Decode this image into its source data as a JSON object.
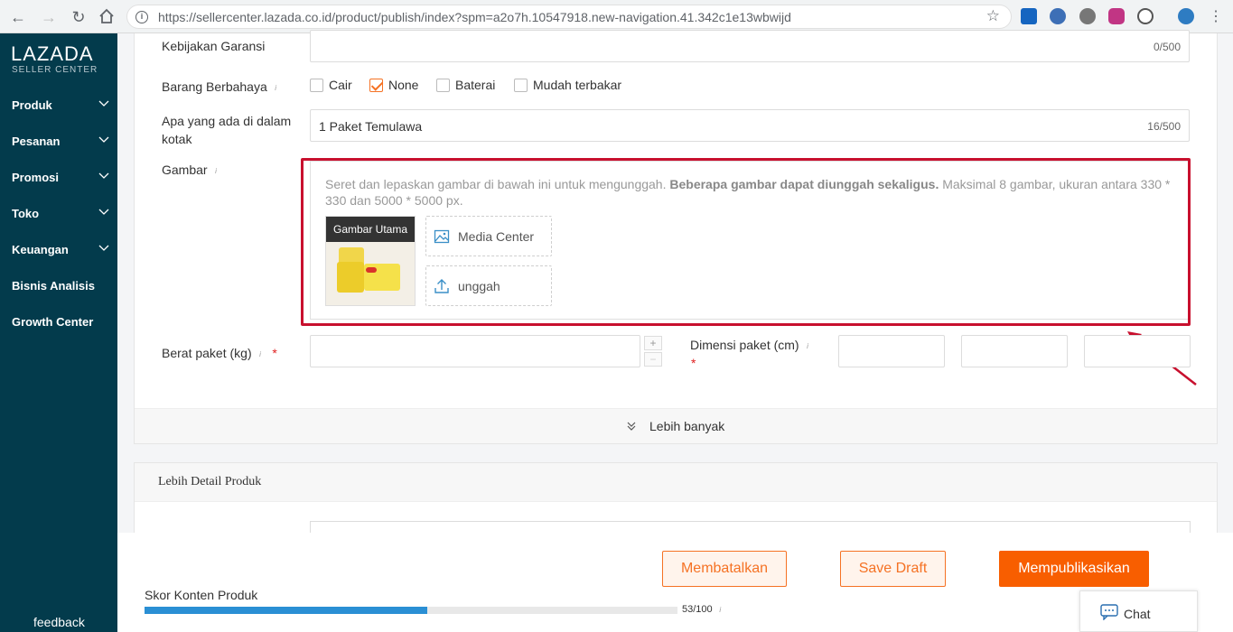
{
  "browser": {
    "url": "https://sellercenter.lazada.co.id/product/publish/index?spm=a2o7h.10547918.new-navigation.41.342c1e13wbwijd"
  },
  "sidebar": {
    "brand": "LAZADA",
    "brand_sub": "SELLER CENTER",
    "items": [
      {
        "label": "Produk",
        "has_chevron": true
      },
      {
        "label": "Pesanan",
        "has_chevron": true
      },
      {
        "label": "Promosi",
        "has_chevron": true
      },
      {
        "label": "Toko",
        "has_chevron": true
      },
      {
        "label": "Keuangan",
        "has_chevron": true
      },
      {
        "label": "Bisnis Analisis",
        "has_chevron": false
      },
      {
        "label": "Growth Center",
        "has_chevron": false
      }
    ],
    "feedback": "feedback"
  },
  "form": {
    "warranty": {
      "label": "Kebijakan Garansi",
      "value": "",
      "count": "0/500"
    },
    "dangerous": {
      "label": "Barang Berbahaya",
      "options": [
        {
          "label": "Cair",
          "checked": false
        },
        {
          "label": "None",
          "checked": true
        },
        {
          "label": "Baterai",
          "checked": false
        },
        {
          "label": "Mudah terbakar",
          "checked": false
        }
      ]
    },
    "box_contents": {
      "label_line1": "Apa yang ada di dalam",
      "label_line2": "kotak",
      "value": "1 Paket Temulawa",
      "count": "16/500"
    },
    "images": {
      "label": "Gambar",
      "hint_prefix": "Seret dan lepaskan gambar di bawah ini untuk mengunggah. ",
      "hint_bold": "Beberapa gambar dapat diunggah sekaligus.",
      "hint_suffix": " Maksimal 8 gambar, ukuran antara 330 * 330 dan 5000 * 5000 px.",
      "main_tag": "Gambar Utama",
      "media_center": "Media Center",
      "upload": "unggah"
    },
    "weight": {
      "label": "Berat paket (kg)",
      "required": "*",
      "plus": "+",
      "minus": "−"
    },
    "dimension": {
      "label": "Dimensi paket (cm)",
      "required": "*"
    },
    "more": "Lebih banyak"
  },
  "detail": {
    "title": "Lebih Detail Produk"
  },
  "footer": {
    "cancel": "Membatalkan",
    "draft": "Save Draft",
    "publish": "Mempublikasikan",
    "score_label": "Skor Konten Produk",
    "score_value": 53,
    "score_text": "53/100",
    "chat": "Chat"
  },
  "colors": {
    "sidebar": "#033b4c",
    "accent": "#f57224",
    "highlight": "#c8102e",
    "progress": "#2a8fd4"
  }
}
